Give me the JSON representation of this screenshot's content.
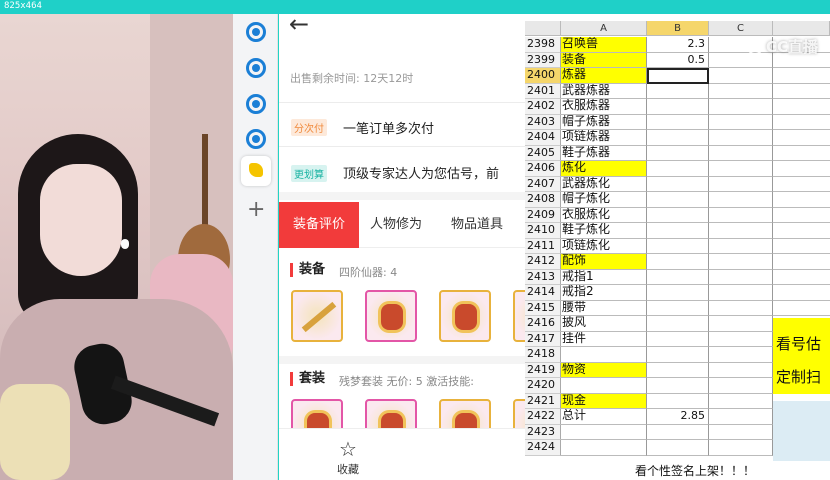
{
  "screen_label": "825x464",
  "page": {
    "sale_remaining": "出售剩余时间: 12天12时",
    "installment_tag": "分次付",
    "installment_text": "一笔订单多次付",
    "valuation_tag": "更划算",
    "valuation_text": "顶级专家达人为您估号，前",
    "tabs": [
      "装备评价",
      "人物修为",
      "物品道具"
    ],
    "equip_title": "装备",
    "equip_sub": "四阶仙器: 4",
    "suit_title": "套装",
    "suit_sub": "残梦套装  无价: 5  激活技能: ",
    "favorite_label": "收藏"
  },
  "sheet": {
    "columns": [
      "A",
      "B",
      "C"
    ],
    "rows": [
      {
        "n": "2398",
        "a": "召唤兽",
        "b": "2.3",
        "yellow": true
      },
      {
        "n": "2399",
        "a": "装备",
        "b": "0.5",
        "yellow": true
      },
      {
        "n": "2400",
        "a": "炼器",
        "b": "",
        "yellow": true,
        "selected": true
      },
      {
        "n": "2401",
        "a": "武器炼器",
        "b": ""
      },
      {
        "n": "2402",
        "a": "衣服炼器",
        "b": ""
      },
      {
        "n": "2403",
        "a": "帽子炼器",
        "b": ""
      },
      {
        "n": "2404",
        "a": "项链炼器",
        "b": ""
      },
      {
        "n": "2405",
        "a": "鞋子炼器",
        "b": ""
      },
      {
        "n": "2406",
        "a": "炼化",
        "b": "",
        "yellow": true
      },
      {
        "n": "2407",
        "a": "武器炼化",
        "b": ""
      },
      {
        "n": "2408",
        "a": "帽子炼化",
        "b": ""
      },
      {
        "n": "2409",
        "a": "衣服炼化",
        "b": ""
      },
      {
        "n": "2410",
        "a": "鞋子炼化",
        "b": ""
      },
      {
        "n": "2411",
        "a": "项链炼化",
        "b": ""
      },
      {
        "n": "2412",
        "a": "配饰",
        "b": "",
        "yellow": true
      },
      {
        "n": "2413",
        "a": "戒指1",
        "b": ""
      },
      {
        "n": "2414",
        "a": "戒指2",
        "b": ""
      },
      {
        "n": "2415",
        "a": "腰带",
        "b": ""
      },
      {
        "n": "2416",
        "a": "披风",
        "b": ""
      },
      {
        "n": "2417",
        "a": "挂件",
        "b": ""
      },
      {
        "n": "2418",
        "a": "",
        "b": ""
      },
      {
        "n": "2419",
        "a": "物资",
        "b": "",
        "yellow": true
      },
      {
        "n": "2420",
        "a": "",
        "b": ""
      },
      {
        "n": "2421",
        "a": "现金",
        "b": "",
        "yellow": true
      },
      {
        "n": "2422",
        "a": "总计",
        "b": "2.85"
      },
      {
        "n": "2423",
        "a": "",
        "b": ""
      },
      {
        "n": "2424",
        "a": "",
        "b": ""
      }
    ],
    "banner_1": "看号估",
    "banner_2": "定制扫",
    "footer_text": "看个性签名上架！！！",
    "watermark": "CC直播"
  }
}
